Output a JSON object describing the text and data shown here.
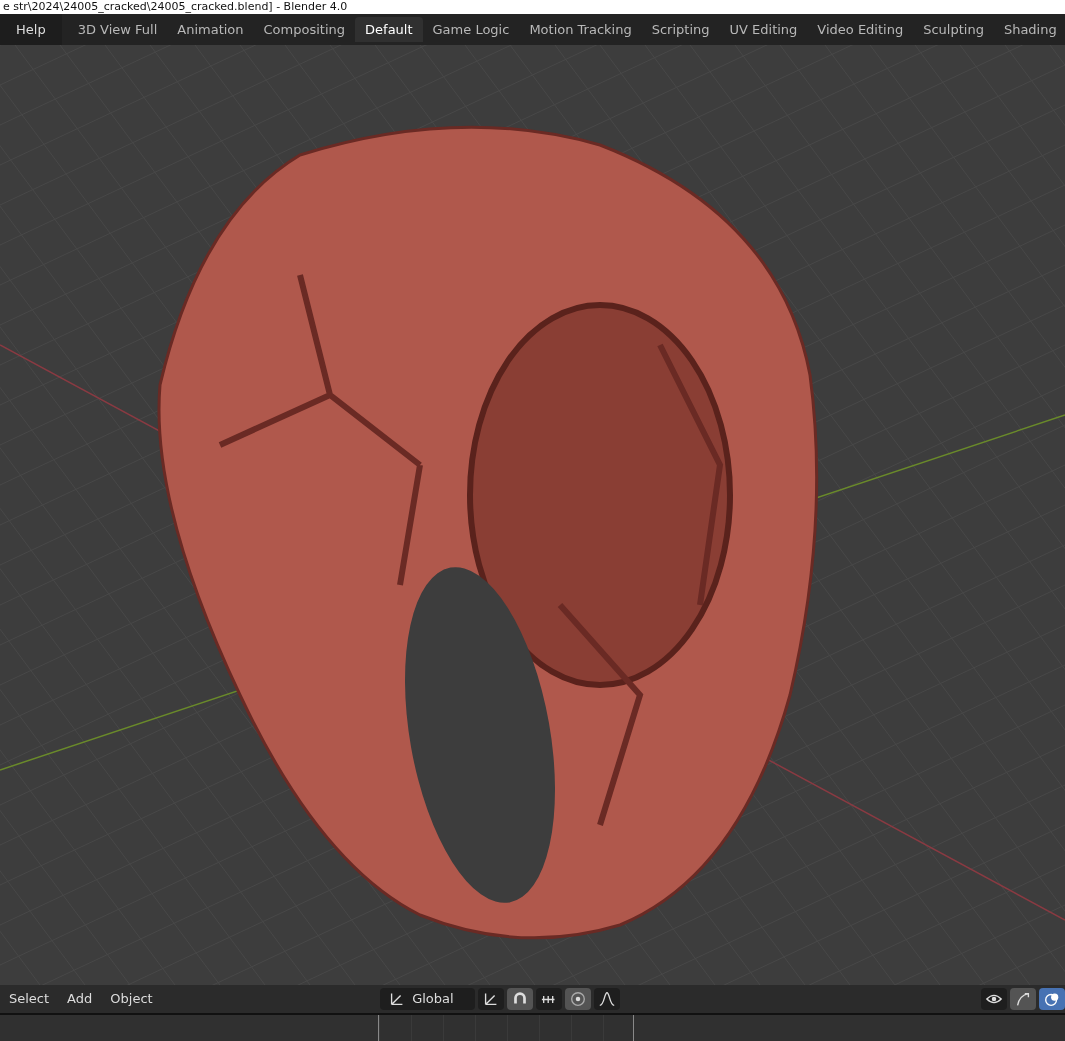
{
  "window": {
    "title": "e str\\2024\\24005_cracked\\24005_cracked.blend] - Blender 4.0"
  },
  "top_bar": {
    "menus": [
      "Help"
    ],
    "workspace_tabs": [
      {
        "label": "3D View Full",
        "selected": false
      },
      {
        "label": "Animation",
        "selected": false
      },
      {
        "label": "Compositing",
        "selected": false
      },
      {
        "label": "Default",
        "selected": true
      },
      {
        "label": "Game Logic",
        "selected": false
      },
      {
        "label": "Motion Tracking",
        "selected": false
      },
      {
        "label": "Scripting",
        "selected": false
      },
      {
        "label": "UV Editing",
        "selected": false
      },
      {
        "label": "Video Editing",
        "selected": false
      },
      {
        "label": "Sculpting",
        "selected": false
      },
      {
        "label": "Shading",
        "selected": false
      }
    ]
  },
  "viewport_header": {
    "menus": [
      "Select",
      "Add",
      "Object"
    ],
    "transform_orientation": "Global",
    "tools": [
      {
        "kind": "pivot",
        "on": false
      },
      {
        "kind": "snap",
        "on": true
      },
      {
        "kind": "snap-target",
        "on": false
      },
      {
        "kind": "proportional",
        "on": true
      },
      {
        "kind": "falloff",
        "on": false
      }
    ],
    "right_tools": [
      {
        "kind": "visibility",
        "on": false
      },
      {
        "kind": "gizmo",
        "on": true
      },
      {
        "kind": "overlay",
        "on": true
      }
    ]
  }
}
